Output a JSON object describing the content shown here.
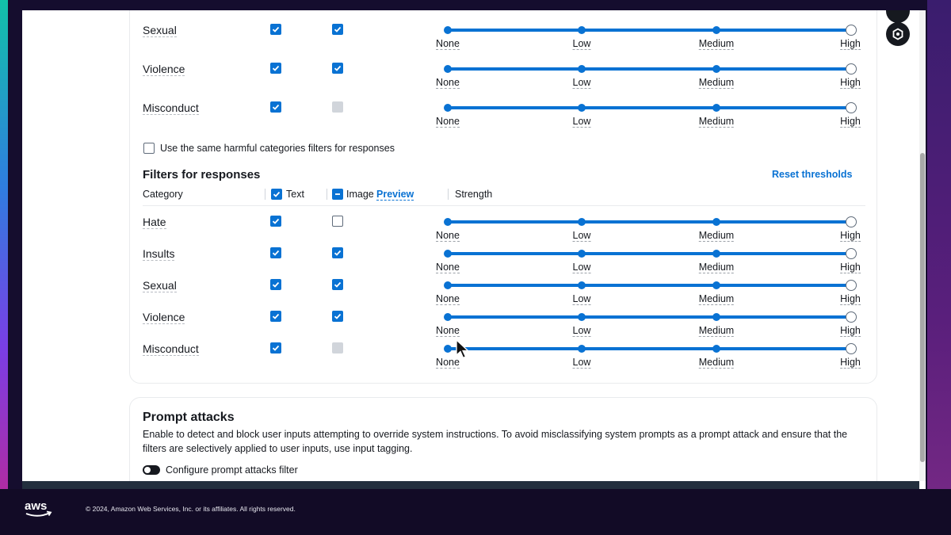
{
  "colors": {
    "accent": "#0972d3",
    "text": "#16191f",
    "border": "#e9ebed"
  },
  "slider_ticks": [
    "None",
    "Low",
    "Medium",
    "High"
  ],
  "prompt_filters": {
    "rows": [
      {
        "label": "Sexual",
        "text": true,
        "image": "checked",
        "level": "High"
      },
      {
        "label": "Violence",
        "text": true,
        "image": "checked",
        "level": "High"
      },
      {
        "label": "Misconduct",
        "text": true,
        "image": "disabled",
        "level": "High"
      }
    ]
  },
  "same_filters_checkbox": {
    "label": "Use the same harmful categories filters for responses",
    "checked": false
  },
  "response_filters": {
    "title": "Filters for responses",
    "reset_link": "Reset thresholds",
    "columns": {
      "category": "Category",
      "text": "Text",
      "image": "Image",
      "preview": "Preview",
      "strength": "Strength"
    },
    "rows": [
      {
        "label": "Hate",
        "text": true,
        "image": "unchecked",
        "level": "High"
      },
      {
        "label": "Insults",
        "text": true,
        "image": "checked",
        "level": "High"
      },
      {
        "label": "Sexual",
        "text": true,
        "image": "checked",
        "level": "High"
      },
      {
        "label": "Violence",
        "text": true,
        "image": "checked",
        "level": "High"
      },
      {
        "label": "Misconduct",
        "text": true,
        "image": "disabled",
        "level": "High"
      }
    ]
  },
  "prompt_attacks": {
    "title": "Prompt attacks",
    "description": "Enable to detect and block user inputs attempting to override system instructions. To avoid misclassifying system prompts as a prompt attack and ensure that the",
    "description_line2": "filters are selectively applied to user inputs, use input tagging.",
    "toggle_label": "Configure prompt attacks filter",
    "toggle_on": false
  },
  "footer": {
    "copyright": "© 2024, Amazon Web Services, Inc. or its affiliates. All rights reserved."
  }
}
